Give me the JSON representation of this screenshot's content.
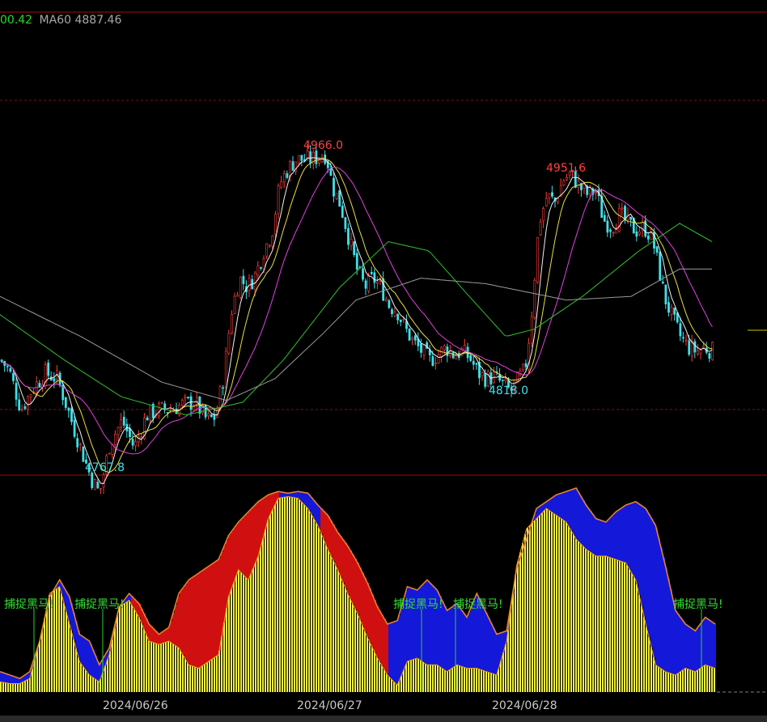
{
  "legend": {
    "items": [
      {
        "label": "00.42",
        "color": "#22dd22"
      },
      {
        "label": "MA60 4887.46",
        "color": "#a8a8a8"
      }
    ]
  },
  "annotations": {
    "high1": "4966.0",
    "high2": "4951.6",
    "low1": "4767.8",
    "low2": "4818.0"
  },
  "signals": [
    {
      "text": "捕捉黑马!"
    },
    {
      "text": "捕捉黑马!"
    },
    {
      "text": "捕捉黑马!"
    },
    {
      "text": "捕捉黑马!"
    },
    {
      "text": "捕捉黑马!"
    }
  ],
  "chart_data": {
    "type": "candlestick",
    "dates": [
      "2024/06/26",
      "2024/06/27",
      "2024/06/28"
    ],
    "price_extremes": {
      "highs": [
        4966.0,
        4951.6
      ],
      "lows": [
        4767.8,
        4818.0
      ]
    },
    "ma60_last": 4887.46,
    "price_path": [
      [
        0,
        4845
      ],
      [
        10,
        4840
      ],
      [
        25,
        4818
      ],
      [
        40,
        4830
      ],
      [
        55,
        4838
      ],
      [
        70,
        4835
      ],
      [
        85,
        4815
      ],
      [
        100,
        4795
      ],
      [
        112,
        4780
      ],
      [
        122,
        4772
      ],
      [
        135,
        4800
      ],
      [
        150,
        4812
      ],
      [
        165,
        4797
      ],
      [
        180,
        4815
      ],
      [
        195,
        4818
      ],
      [
        210,
        4818
      ],
      [
        225,
        4821
      ],
      [
        240,
        4822
      ],
      [
        255,
        4812
      ],
      [
        265,
        4814
      ],
      [
        275,
        4835
      ],
      [
        285,
        4872
      ],
      [
        295,
        4890
      ],
      [
        305,
        4885
      ],
      [
        315,
        4892
      ],
      [
        325,
        4905
      ],
      [
        335,
        4915
      ],
      [
        345,
        4942
      ],
      [
        355,
        4950
      ],
      [
        365,
        4955
      ],
      [
        375,
        4955
      ],
      [
        385,
        4955
      ],
      [
        395,
        4957
      ],
      [
        402,
        4958
      ],
      [
        410,
        4940
      ],
      [
        420,
        4930
      ],
      [
        430,
        4912
      ],
      [
        440,
        4895
      ],
      [
        450,
        4885
      ],
      [
        460,
        4890
      ],
      [
        470,
        4885
      ],
      [
        480,
        4875
      ],
      [
        490,
        4872
      ],
      [
        500,
        4862
      ],
      [
        510,
        4855
      ],
      [
        520,
        4850
      ],
      [
        530,
        4845
      ],
      [
        540,
        4848
      ],
      [
        550,
        4852
      ],
      [
        560,
        4848
      ],
      [
        570,
        4850
      ],
      [
        580,
        4846
      ],
      [
        590,
        4838
      ],
      [
        600,
        4835
      ],
      [
        610,
        4836
      ],
      [
        620,
        4832
      ],
      [
        630,
        4828
      ],
      [
        640,
        4835
      ],
      [
        648,
        4840
      ],
      [
        655,
        4865
      ],
      [
        665,
        4920
      ],
      [
        675,
        4935
      ],
      [
        685,
        4932
      ],
      [
        695,
        4944
      ],
      [
        705,
        4947
      ],
      [
        715,
        4940
      ],
      [
        725,
        4936
      ],
      [
        735,
        4938
      ],
      [
        745,
        4922
      ],
      [
        755,
        4918
      ],
      [
        765,
        4925
      ],
      [
        775,
        4920
      ],
      [
        785,
        4916
      ],
      [
        795,
        4918
      ],
      [
        805,
        4912
      ],
      [
        812,
        4898
      ],
      [
        820,
        4880
      ],
      [
        830,
        4868
      ],
      [
        840,
        4858
      ],
      [
        850,
        4852
      ],
      [
        860,
        4850
      ],
      [
        870,
        4852
      ],
      [
        880,
        4850
      ]
    ],
    "ma60_path": [
      [
        0,
        4880
      ],
      [
        100,
        4858
      ],
      [
        200,
        4833
      ],
      [
        280,
        4823
      ],
      [
        340,
        4835
      ],
      [
        400,
        4860
      ],
      [
        440,
        4878
      ],
      [
        520,
        4890
      ],
      [
        600,
        4887
      ],
      [
        700,
        4878
      ],
      [
        780,
        4880
      ],
      [
        840,
        4895
      ],
      [
        880,
        4895
      ]
    ],
    "ma_green_path": [
      [
        0,
        4870
      ],
      [
        80,
        4845
      ],
      [
        150,
        4825
      ],
      [
        230,
        4815
      ],
      [
        300,
        4822
      ],
      [
        350,
        4845
      ],
      [
        420,
        4885
      ],
      [
        480,
        4910
      ],
      [
        530,
        4905
      ],
      [
        580,
        4880
      ],
      [
        625,
        4858
      ],
      [
        660,
        4862
      ],
      [
        720,
        4880
      ],
      [
        790,
        4905
      ],
      [
        840,
        4920
      ],
      [
        880,
        4910
      ]
    ],
    "oscillator": {
      "channel": [
        0.12,
        0.1,
        0.08,
        0.12,
        0.3,
        0.56,
        0.66,
        0.56,
        0.34,
        0.3,
        0.16,
        0.26,
        0.5,
        0.58,
        0.52,
        0.4,
        0.34,
        0.38,
        0.58,
        0.66,
        0.7,
        0.74,
        0.78,
        0.92,
        1.0,
        1.06,
        1.12,
        1.16,
        1.18,
        1.17,
        1.18,
        1.17,
        1.1,
        1.04,
        0.94,
        0.86,
        0.76,
        0.64,
        0.5,
        0.4,
        0.42,
        0.62,
        0.6,
        0.66,
        0.6,
        0.48,
        0.52,
        0.44,
        0.58,
        0.46,
        0.34,
        0.36,
        0.72,
        0.9,
        1.08,
        1.12,
        1.16,
        1.18,
        1.2,
        1.1,
        1.02,
        1.0,
        1.06,
        1.1,
        1.12,
        1.08,
        0.98,
        0.74,
        0.48,
        0.4,
        0.36,
        0.44,
        0.4
      ],
      "line": [
        0.06,
        0.05,
        0.05,
        0.08,
        0.3,
        0.58,
        0.62,
        0.4,
        0.18,
        0.1,
        0.06,
        0.22,
        0.5,
        0.54,
        0.44,
        0.3,
        0.28,
        0.3,
        0.26,
        0.16,
        0.14,
        0.18,
        0.22,
        0.56,
        0.72,
        0.66,
        0.8,
        1.02,
        1.14,
        1.15,
        1.14,
        1.08,
        0.98,
        0.84,
        0.72,
        0.58,
        0.46,
        0.32,
        0.2,
        0.1,
        0.04,
        0.18,
        0.2,
        0.16,
        0.16,
        0.12,
        0.16,
        0.14,
        0.14,
        0.12,
        0.1,
        0.3,
        0.74,
        0.96,
        1.02,
        1.08,
        1.04,
        1.0,
        0.9,
        0.84,
        0.8,
        0.8,
        0.78,
        0.76,
        0.66,
        0.4,
        0.16,
        0.12,
        0.1,
        0.14,
        0.12,
        0.16,
        0.14
      ]
    }
  }
}
